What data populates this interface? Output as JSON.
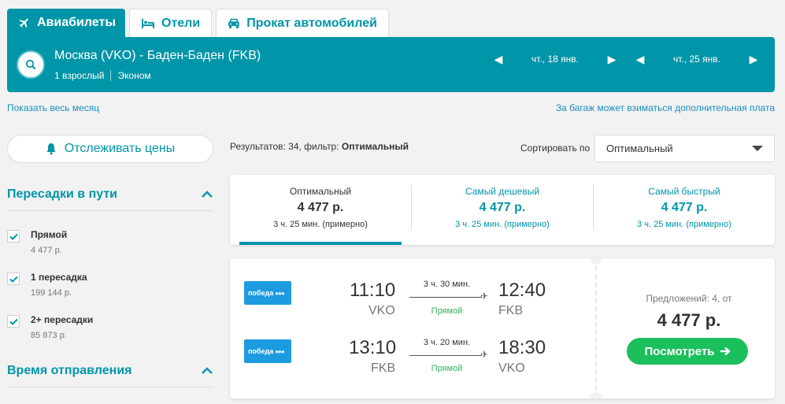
{
  "tabs": [
    {
      "label": "Авиабилеты",
      "icon": "plane-icon",
      "active": true
    },
    {
      "label": "Отели",
      "icon": "bed-icon",
      "active": false
    },
    {
      "label": "Прокат автомобилей",
      "icon": "car-icon",
      "active": false
    }
  ],
  "search": {
    "route": "Москва (VKO) - Баден-Баден (FKB)",
    "passengers": "1 взрослый",
    "cabin": "Эконом",
    "depart_date": "чт., 18 янв.",
    "return_date": "чт., 25 янв."
  },
  "links": {
    "whole_month": "Показать весь месяц",
    "baggage_note": "За багаж может взиматься дополнительная плата"
  },
  "sidebar": {
    "track_prices": "Отслеживать цены",
    "stops_title": "Пересадки в пути",
    "stops": [
      {
        "label": "Прямой",
        "price": "4 477 р.",
        "checked": true
      },
      {
        "label": "1 пересадка",
        "price": "199 144 р.",
        "checked": true
      },
      {
        "label": "2+ пересадки",
        "price": "85 873 р.",
        "checked": true
      }
    ],
    "departure_title": "Время отправления"
  },
  "results": {
    "prefix": "Результатов: 34, фильтр: ",
    "filter": "Оптимальный",
    "sort_label": "Сортировать по",
    "sort_value": "Оптимальный"
  },
  "sort_options": [
    {
      "title": "Оптимальный",
      "price": "4 477 р.",
      "duration": "3 ч. 25 мин. (примерно)",
      "active": true
    },
    {
      "title": "Самый дешевый",
      "price": "4 477 р.",
      "duration": "3 ч. 25 мин. (примерно)",
      "active": false
    },
    {
      "title": "Самый быстрый",
      "price": "4 477 р.",
      "duration": "3 ч. 25 мин. (примерно)",
      "active": false
    }
  ],
  "flight": {
    "legs": [
      {
        "airline": "победа",
        "dep_time": "11:10",
        "dep_code": "VKO",
        "duration": "3 ч. 30 мин.",
        "stops": "Прямой",
        "arr_time": "12:40",
        "arr_code": "FKB"
      },
      {
        "airline": "победа",
        "dep_time": "13:10",
        "dep_code": "FKB",
        "duration": "3 ч. 20 мин.",
        "stops": "Прямой",
        "arr_time": "18:30",
        "arr_code": "VKO"
      }
    ],
    "offers": "Предложений: 4, от",
    "price": "4 477 р.",
    "view_button": "Посмотреть"
  },
  "colors": {
    "brand": "#0095a8",
    "cta_green": "#1bbf5b",
    "link_blue": "#1a8fc2",
    "airline_blue": "#1d9be0"
  }
}
